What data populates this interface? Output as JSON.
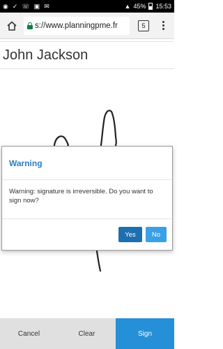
{
  "status_bar": {
    "battery": "45%",
    "time": "15:53"
  },
  "browser": {
    "url": "s://www.planningpme.fr",
    "tab_count": "5"
  },
  "form": {
    "name": "John Jackson"
  },
  "dialog": {
    "title": "Warning",
    "message": "Warning: signature is irreversible. Do you want to sign now?",
    "yes_label": "Yes",
    "no_label": "No"
  },
  "actions": {
    "cancel_label": "Cancel",
    "clear_label": "Clear",
    "sign_label": "Sign"
  },
  "colors": {
    "accent": "#2a7fc0",
    "sign_button": "#2590d8",
    "yes_button": "#1e6fb0",
    "no_button": "#3aa0e6"
  }
}
